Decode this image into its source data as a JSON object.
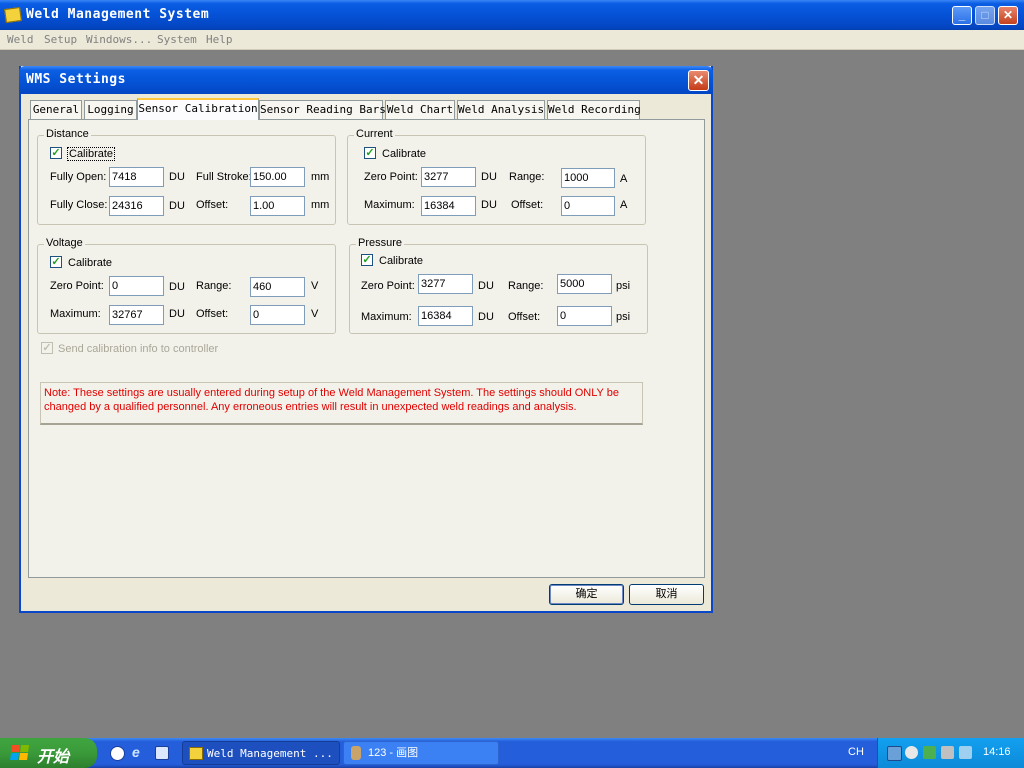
{
  "window": {
    "title": "Weld Management System",
    "minimize": "_",
    "maximize": "□",
    "close": "✕"
  },
  "menu": [
    "Weld",
    "Setup",
    "Windows...",
    "System",
    "Help"
  ],
  "dialog": {
    "title": "WMS Settings",
    "close": "✕",
    "tabs": [
      "General",
      "Logging",
      "Sensor Calibration",
      "Sensor Reading Bars",
      "Weld Chart",
      "Weld Analysis",
      "Weld Recording"
    ],
    "active_tab": "Sensor Calibration",
    "distance": {
      "label": "Distance",
      "calibrate_label": "Calibrate",
      "calibrate_checked": true,
      "fully_open_label": "Fully Open:",
      "fully_open": "7418",
      "fully_open_unit": "DU",
      "full_stroke_label": "Full Stroke:",
      "full_stroke": "150.00",
      "full_stroke_unit": "mm",
      "fully_close_label": "Fully Close:",
      "fully_close": "24316",
      "fully_close_unit": "DU",
      "offset_label": "Offset:",
      "offset": "1.00",
      "offset_unit": "mm"
    },
    "current": {
      "label": "Current",
      "calibrate_label": "Calibrate",
      "calibrate_checked": true,
      "zero_label": "Zero Point:",
      "zero": "3277",
      "zero_unit": "DU",
      "range_label": "Range:",
      "range": "1000",
      "range_unit": "A",
      "max_label": "Maximum:",
      "max": "16384",
      "max_unit": "DU",
      "offset_label": "Offset:",
      "offset": "0",
      "offset_unit": "A"
    },
    "voltage": {
      "label": "Voltage",
      "calibrate_label": "Calibrate",
      "calibrate_checked": true,
      "zero_label": "Zero Point:",
      "zero": "0",
      "zero_unit": "DU",
      "range_label": "Range:",
      "range": "460",
      "range_unit": "V",
      "max_label": "Maximum:",
      "max": "32767",
      "max_unit": "DU",
      "offset_label": "Offset:",
      "offset": "0",
      "offset_unit": "V"
    },
    "pressure": {
      "label": "Pressure",
      "calibrate_label": "Calibrate",
      "calibrate_checked": true,
      "zero_label": "Zero Point:",
      "zero": "3277",
      "zero_unit": "DU",
      "range_label": "Range:",
      "range": "5000",
      "range_unit": "psi",
      "max_label": "Maximum:",
      "max": "16384",
      "max_unit": "DU",
      "offset_label": "Offset:",
      "offset": "0",
      "offset_unit": "psi"
    },
    "send_calibration_label": "Send calibration info to controller",
    "note": "Note: These settings are usually entered during setup of the Weld Management System. The settings should ONLY be changed by a qualified personnel. Any erroneous entries will result in unexpected weld readings and analysis.",
    "ok_label": "确定",
    "cancel_label": "取消"
  },
  "taskbar": {
    "start_label": "开始",
    "tasks": [
      "Weld Management ...",
      "123 - 画图"
    ],
    "language": "CH",
    "clock": "14:16"
  },
  "colors": {
    "titlebar": "#0553d7",
    "note_text": "#e00000",
    "taskbar": "#245edb",
    "start": "#3a9a3a",
    "desktop": "#808080"
  },
  "icons": [
    "app-icon",
    "windows-logo-icon",
    "media-player-icon",
    "internet-explorer-icon",
    "show-desktop-icon",
    "paint-icon",
    "network-icon",
    "volume-icon",
    "tray-app-icon"
  ]
}
